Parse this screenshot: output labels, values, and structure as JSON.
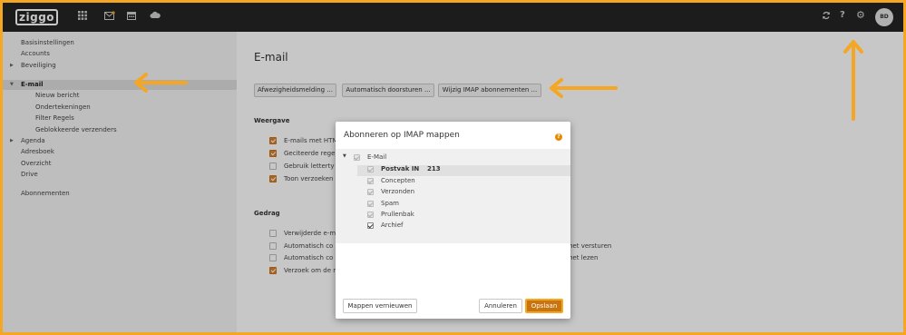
{
  "brand": "ziggo",
  "user_initials": "BD",
  "sidebar": {
    "items": [
      {
        "label": "Basisinstellingen"
      },
      {
        "label": "Accounts"
      },
      {
        "label": "Beveiliging"
      },
      {
        "label": "E-mail"
      },
      {
        "label": "Nieuw bericht"
      },
      {
        "label": "Ondertekeningen"
      },
      {
        "label": "Filter Regels"
      },
      {
        "label": "Geblokkeerde verzenders"
      },
      {
        "label": "Agenda"
      },
      {
        "label": "Adresboek"
      },
      {
        "label": "Overzicht"
      },
      {
        "label": "Drive"
      },
      {
        "label": "Abonnementen"
      }
    ]
  },
  "main": {
    "title": "E-mail",
    "buttons": [
      "Afwezigheidsmelding ...",
      "Automatisch doorsturen ...",
      "Wijzig IMAP abonnementen ..."
    ],
    "section_weergave": "Weergave",
    "weergave_options": [
      {
        "label": "E-mails met HTM",
        "checked": true
      },
      {
        "label": "Geciteerde regel",
        "checked": true
      },
      {
        "label": "Gebruik letterty",
        "checked": false
      },
      {
        "label": "Toon verzoeken",
        "checked": true
      }
    ],
    "section_gedrag": "Gedrag",
    "gedrag_options": [
      {
        "label": "Verwijderde e-m",
        "checked": false
      },
      {
        "label": "Automatisch co",
        "checked": false,
        "right": "het versturen"
      },
      {
        "label": "Automatisch co",
        "checked": false,
        "right": "het lezen"
      },
      {
        "label": "Verzoek om de n",
        "checked": true
      }
    ]
  },
  "modal": {
    "title": "Abonneren op IMAP mappen",
    "root": "E-Mail",
    "folders": [
      {
        "label": "Postvak IN",
        "count": "213",
        "checked": true,
        "bold": true
      },
      {
        "label": "Concepten",
        "checked": true
      },
      {
        "label": "Verzonden",
        "checked": true
      },
      {
        "label": "Spam",
        "checked": true
      },
      {
        "label": "Prullenbak",
        "checked": true
      },
      {
        "label": "Archief",
        "checked": true
      }
    ],
    "refresh_label": "Mappen vernieuwen",
    "cancel_label": "Annuleren",
    "save_label": "Opslaan"
  },
  "colors": {
    "accent": "#d9822b",
    "annotation": "#f5a623",
    "topbar": "#242424"
  },
  "icons": [
    "apps-icon",
    "mail-icon",
    "calendar-icon",
    "cloud-icon",
    "refresh-icon",
    "help-icon",
    "gear-icon"
  ]
}
